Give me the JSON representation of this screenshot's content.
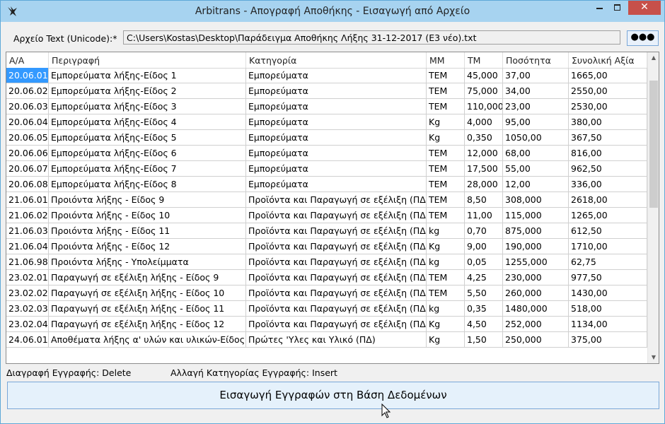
{
  "window": {
    "title": "Arbitrans - Απογραφή Αποθήκης - Εισαγωγή από Αρχείο",
    "close_glyph": "✕"
  },
  "file": {
    "label": "Αρχείο Text (Unicode):*",
    "path": "C:\\Users\\Kostas\\Desktop\\Παράδειγμα Αποθήκης Λήξης 31-12-2017 (E3 νέο).txt",
    "browse_label": "●●●"
  },
  "table": {
    "columns": [
      "Α/Α",
      "Περιγραφή",
      "Κατηγορία",
      "ΜΜ",
      "ΤΜ",
      "Ποσότητα",
      "Συνολική Αξία"
    ],
    "rows": [
      [
        "20.06.01",
        "Εμπορεύματα λήξης-Είδος 1",
        "Εμπορεύματα",
        "TEM",
        "45,000",
        "37,00",
        "1665,00"
      ],
      [
        "20.06.02",
        "Εμπορεύματα λήξης-Είδος 2",
        "Εμπορεύματα",
        "TEM",
        "75,000",
        "34,00",
        "2550,00"
      ],
      [
        "20.06.03",
        "Εμπορεύματα λήξης-Είδος 3",
        "Εμπορεύματα",
        "TEM",
        "110,000",
        "23,00",
        "2530,00"
      ],
      [
        "20.06.04",
        "Εμπορεύματα λήξης-Είδος 4",
        "Εμπορεύματα",
        "Kg",
        "4,000",
        "95,00",
        "380,00"
      ],
      [
        "20.06.05",
        "Εμπορεύματα λήξης-Είδος 5",
        "Εμπορεύματα",
        "Kg",
        "0,350",
        "1050,00",
        "367,50"
      ],
      [
        "20.06.06",
        "Εμπορεύματα λήξης-Είδος 6",
        "Εμπορεύματα",
        "TEM",
        "12,000",
        "68,00",
        "816,00"
      ],
      [
        "20.06.07",
        "Εμπορεύματα λήξης-Είδος 7",
        "Εμπορεύματα",
        "TEM",
        "17,500",
        "55,00",
        "962,50"
      ],
      [
        "20.06.08",
        "Εμπορεύματα λήξης-Είδος 8",
        "Εμπορεύματα",
        "TEM",
        "28,000",
        "12,00",
        "336,00"
      ],
      [
        "21.06.01",
        "Προιόντα λήξης - Είδος 9",
        "Προϊόντα και Παραγωγή σε εξέλιξη (ΠΔ)",
        "TEM",
        "8,50",
        "308,000",
        "2618,00"
      ],
      [
        "21.06.02",
        "Προιόντα λήξης - Είδος 10",
        "Προϊόντα και Παραγωγή σε εξέλιξη (ΠΔ)",
        "TEM",
        "11,00",
        "115,000",
        "1265,00"
      ],
      [
        "21.06.03",
        "Προιόντα λήξης - Είδος 11",
        "Προϊόντα και Παραγωγή σε εξέλιξη (ΠΔ)",
        "kg",
        "0,70",
        "875,000",
        "612,50"
      ],
      [
        "21.06.04",
        "Προιόντα λήξης - Είδος 12",
        "Προϊόντα και Παραγωγή σε εξέλιξη (ΠΔ)",
        "Kg",
        "9,00",
        "190,000",
        "1710,00"
      ],
      [
        "21.06.98",
        "Προιόντα λήξης - Υπολείμματα",
        "Προϊόντα και Παραγωγή σε εξέλιξη (ΠΔ)",
        "kg",
        "0,05",
        "1255,000",
        "62,75"
      ],
      [
        "23.02.01",
        "Παραγωγή σε εξέλιξη λήξης - Είδος 9",
        "Προϊόντα και Παραγωγή σε εξέλιξη (ΠΔ)",
        "TEM",
        "4,25",
        "230,000",
        "977,50"
      ],
      [
        "23.02.02",
        "Παραγωγή σε εξέλιξη λήξης - Είδος 10",
        "Προϊόντα και Παραγωγή σε εξέλιξη (ΠΔ)",
        "TEM",
        "5,50",
        "260,000",
        "1430,00"
      ],
      [
        "23.02.03",
        "Παραγωγή σε εξέλιξη λήξης - Είδος 11",
        "Προϊόντα και Παραγωγή σε εξέλιξη (ΠΔ)",
        "kg",
        "0,35",
        "1480,000",
        "518,00"
      ],
      [
        "23.02.04",
        "Παραγωγή σε εξέλιξη λήξης - Είδος 12",
        "Προϊόντα και Παραγωγή σε εξέλιξη (ΠΔ)",
        "Kg",
        "4,50",
        "252,000",
        "1134,00"
      ],
      [
        "24.06.01",
        "Αποθέματα λήξης α' υλών και υλικών-Είδος 13",
        "Πρώτες 'Υλες και Υλικό (ΠΔ)",
        "Kg",
        "1,50",
        "250,000",
        "375,00"
      ]
    ]
  },
  "hints": {
    "delete": "Διαγραφή Εγγραφής: Delete",
    "insert": "Αλλαγή Κατηγορίας Εγγραφής: Insert"
  },
  "actions": {
    "import_label": "Εισαγωγή Εγγραφών στη Βάση Δεδομένων"
  }
}
